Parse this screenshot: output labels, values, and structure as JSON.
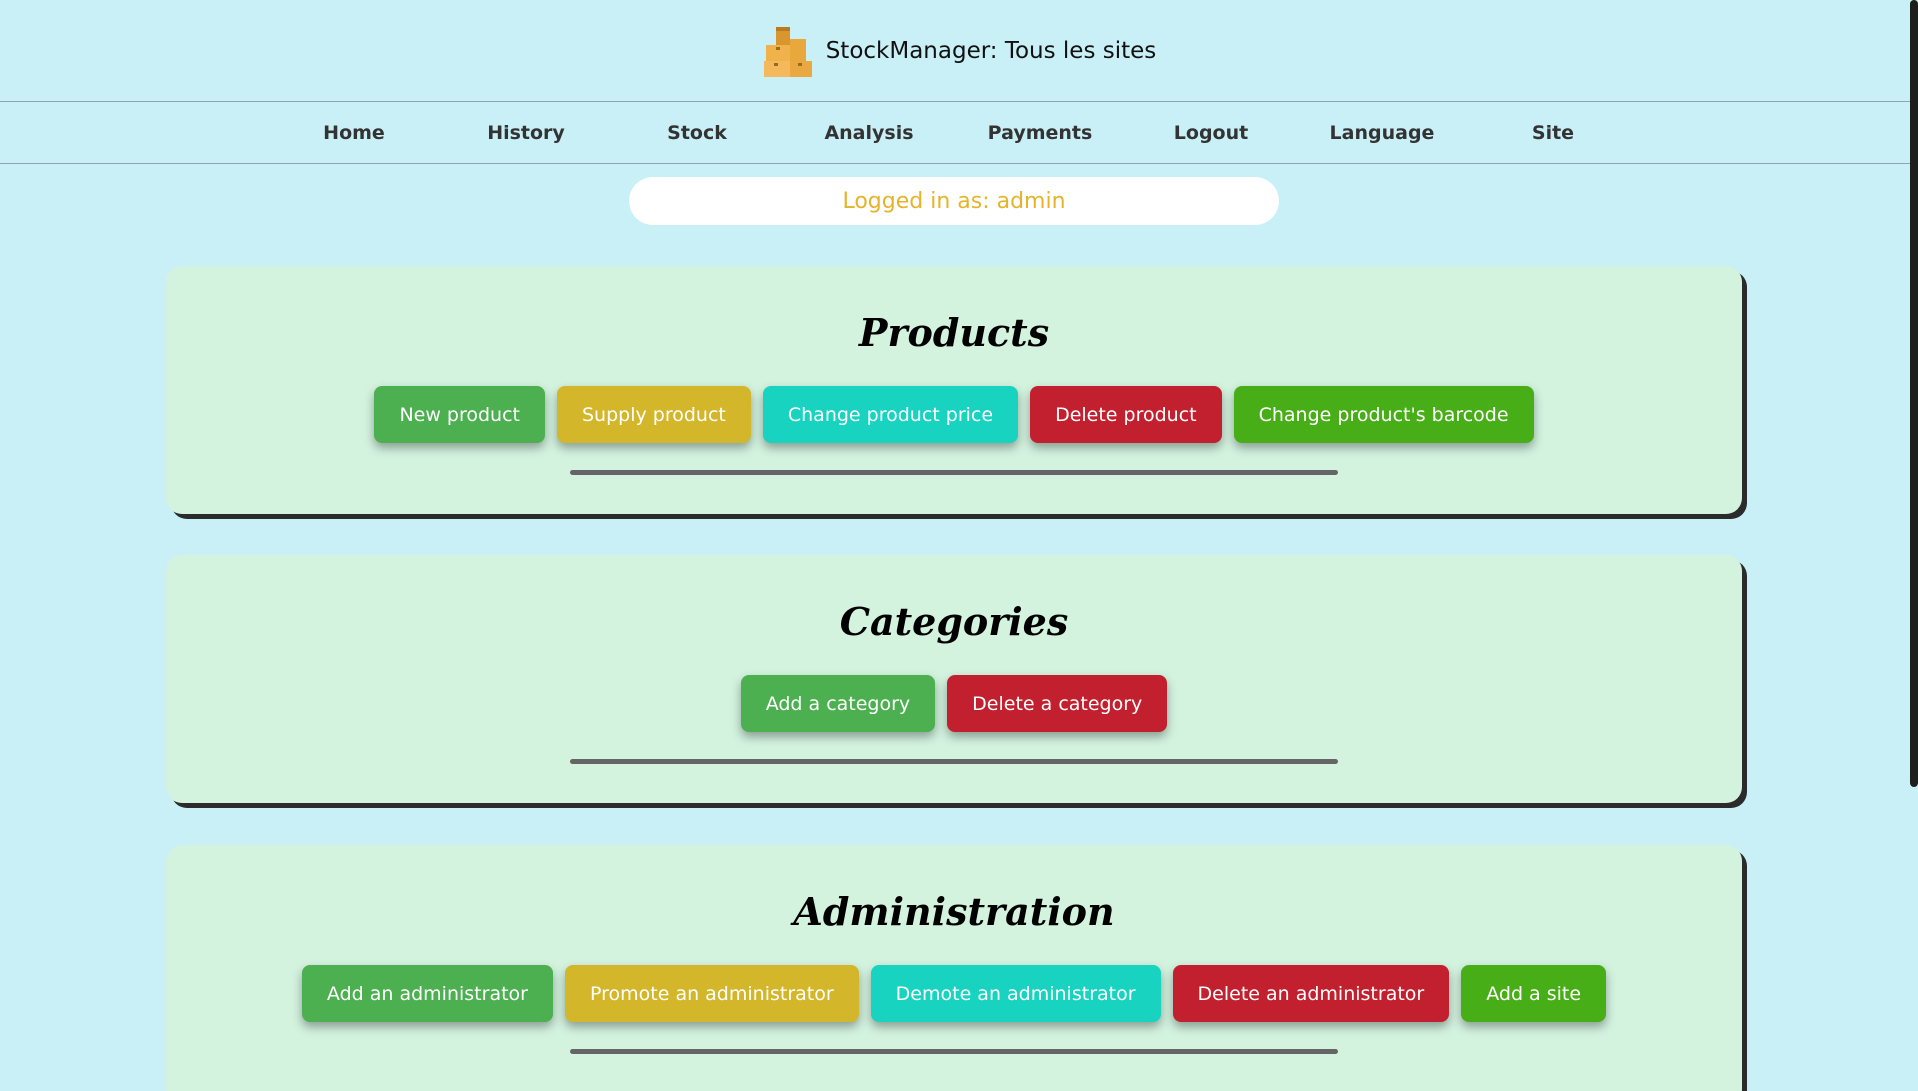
{
  "header": {
    "title": "StockManager: Tous les sites",
    "logo_icon": "boxes-icon"
  },
  "nav": {
    "items": [
      {
        "label": "Home"
      },
      {
        "label": "History"
      },
      {
        "label": "Stock"
      },
      {
        "label": "Analysis"
      },
      {
        "label": "Payments"
      },
      {
        "label": "Logout"
      },
      {
        "label": "Language"
      },
      {
        "label": "Site"
      }
    ]
  },
  "login": {
    "text": "Logged in as: admin"
  },
  "sections": {
    "products": {
      "title": "Products",
      "buttons": [
        {
          "label": "New product",
          "color": "#4caf50"
        },
        {
          "label": "Supply product",
          "color": "#d4b62a"
        },
        {
          "label": "Change product price",
          "color": "#17d3c0"
        },
        {
          "label": "Delete product",
          "color": "#c3202f"
        },
        {
          "label": "Change product's barcode",
          "color": "#48ae18"
        }
      ]
    },
    "categories": {
      "title": "Categories",
      "buttons": [
        {
          "label": "Add a category",
          "color": "#4caf50"
        },
        {
          "label": "Delete a category",
          "color": "#c3202f"
        }
      ]
    },
    "administration": {
      "title": "Administration",
      "buttons": [
        {
          "label": "Add an administrator",
          "color": "#4caf50"
        },
        {
          "label": "Promote an administrator",
          "color": "#d4b62a"
        },
        {
          "label": "Demote an administrator",
          "color": "#17d3c0"
        },
        {
          "label": "Delete an administrator",
          "color": "#c3202f"
        },
        {
          "label": "Add a site",
          "color": "#48ae18"
        }
      ]
    }
  },
  "colors": {
    "background": "#c9f0f7",
    "section_bg": "#d3f3df",
    "login_text": "#e6b32a"
  }
}
